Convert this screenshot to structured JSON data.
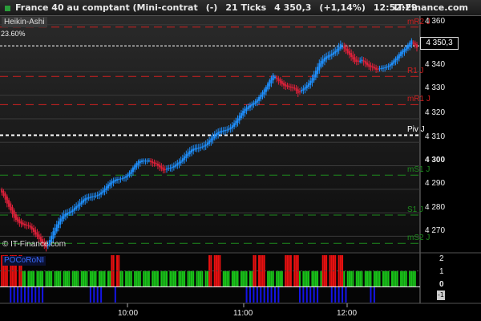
{
  "title_bar": {
    "instrument": "France 40 au comptant (Mini-contrat",
    "mode": "(-)",
    "interval": "21 Ticks",
    "price": "4 350,3",
    "change": "(+1,14%)",
    "time": "12:52:29",
    "brand": "IT-Finance.com"
  },
  "chart_label": "Heikin-Ashi",
  "fib_label": "23.60%",
  "watermark": "© IT-Finance.com",
  "indicator_label": "POCoRoNI",
  "last_price_box": "4 350,3",
  "pivot_labels": [
    "mR2 J",
    "R1 J",
    "mR1 J",
    "Piv J",
    "mS1 J",
    "S1 J",
    "mS2 J"
  ],
  "y_axis_labels": [
    "4 360",
    "4 340",
    "4 330",
    "4 320",
    "4 310",
    "4 300",
    "4 290",
    "4 280",
    "4 270"
  ],
  "x_axis_labels": [
    "10:00",
    "11:00",
    "12:00"
  ],
  "indicator_axis_labels": [
    "2",
    "1",
    "0",
    "-1"
  ],
  "colors": {
    "up_candle": "#1e90ff",
    "down_candle": "#e0203a",
    "resistance": "#d02020",
    "support": "#1e8c1e",
    "pivot": "#ffffff",
    "hist_red": "#e81010",
    "hist_green": "#19c319",
    "hist_blue": "#1414e6"
  },
  "chart_data": {
    "type": "candlestick",
    "y_unit": "points",
    "ylim": [
      4264,
      4363
    ],
    "x_ticks": [
      "10:00",
      "11:00",
      "12:00"
    ],
    "last_price": 4350.3,
    "levels": [
      {
        "name": "mR2 J",
        "value": 4359,
        "style": "dashed",
        "color": "#d02020"
      },
      {
        "name": "R1 J",
        "value": 4338,
        "style": "dashed",
        "color": "#d02020"
      },
      {
        "name": "mR1 J",
        "value": 4326,
        "style": "dashed",
        "color": "#d02020"
      },
      {
        "name": "Piv J",
        "value": 4313,
        "style": "dashed",
        "color": "#ffffff"
      },
      {
        "name": "mS1 J",
        "value": 4296,
        "style": "dashed",
        "color": "#1e8c1e"
      },
      {
        "name": "S1 J",
        "value": 4279,
        "style": "dashed",
        "color": "#1e8c1e"
      },
      {
        "name": "mS2 J",
        "value": 4267,
        "style": "dashed",
        "color": "#1e8c1e"
      }
    ],
    "fib_level": {
      "label": "23.60%",
      "value": 4351
    },
    "price_path": [
      [
        0,
        4290
      ],
      [
        4,
        4283
      ],
      [
        8,
        4278
      ],
      [
        12,
        4276
      ],
      [
        16,
        4274
      ],
      [
        20,
        4270
      ],
      [
        23,
        4268
      ],
      [
        26,
        4266
      ],
      [
        30,
        4272
      ],
      [
        36,
        4279
      ],
      [
        42,
        4283
      ],
      [
        50,
        4286
      ],
      [
        58,
        4290
      ],
      [
        66,
        4294
      ],
      [
        72,
        4297
      ],
      [
        78,
        4301
      ],
      [
        84,
        4303
      ],
      [
        88,
        4301
      ],
      [
        92,
        4297
      ],
      [
        96,
        4299
      ],
      [
        100,
        4302
      ],
      [
        106,
        4305
      ],
      [
        112,
        4308
      ],
      [
        120,
        4312
      ],
      [
        128,
        4316
      ],
      [
        134,
        4320
      ],
      [
        140,
        4325
      ],
      [
        146,
        4330
      ],
      [
        150,
        4333
      ],
      [
        154,
        4338
      ],
      [
        158,
        4336
      ],
      [
        162,
        4334
      ],
      [
        166,
        4332
      ],
      [
        168,
        4330
      ],
      [
        172,
        4334
      ],
      [
        176,
        4338
      ],
      [
        180,
        4343
      ],
      [
        184,
        4346
      ],
      [
        188,
        4349
      ],
      [
        192,
        4352
      ],
      [
        196,
        4347
      ],
      [
        200,
        4344
      ],
      [
        204,
        4346
      ],
      [
        208,
        4342
      ],
      [
        212,
        4340
      ],
      [
        216,
        4342
      ],
      [
        220,
        4344
      ],
      [
        224,
        4346
      ],
      [
        228,
        4349
      ],
      [
        232,
        4354
      ],
      [
        235,
        4351
      ]
    ],
    "indicator": {
      "name": "POCoRoNI",
      "ylim": [
        -1,
        2
      ],
      "segments": [
        {
          "start": 0,
          "end": 12,
          "value": 1.5,
          "color": "red"
        },
        {
          "start": 12,
          "end": 62,
          "value": 0.5,
          "color": "green"
        },
        {
          "start": 62,
          "end": 67,
          "value": 1.5,
          "color": "red"
        },
        {
          "start": 67,
          "end": 100,
          "value": 0.5,
          "color": "green"
        },
        {
          "start": 100,
          "end": 117,
          "value": 0.5,
          "color": "green"
        },
        {
          "start": 117,
          "end": 125,
          "value": 1.5,
          "color": "red"
        },
        {
          "start": 125,
          "end": 142,
          "value": 0.5,
          "color": "green"
        },
        {
          "start": 142,
          "end": 150,
          "value": 1.5,
          "color": "red"
        },
        {
          "start": 150,
          "end": 160,
          "value": 0.5,
          "color": "green"
        },
        {
          "start": 160,
          "end": 168,
          "value": 1.5,
          "color": "red"
        },
        {
          "start": 168,
          "end": 181,
          "value": 0.5,
          "color": "green"
        },
        {
          "start": 181,
          "end": 193,
          "value": 1.5,
          "color": "red"
        },
        {
          "start": 193,
          "end": 235,
          "value": 0.5,
          "color": "green"
        }
      ],
      "negative_spans": [
        {
          "start": 5,
          "end": 25
        },
        {
          "start": 50,
          "end": 58
        },
        {
          "start": 64,
          "end": 66
        },
        {
          "start": 138,
          "end": 158
        },
        {
          "start": 168,
          "end": 180
        },
        {
          "start": 186,
          "end": 196
        },
        {
          "start": 208,
          "end": 212
        }
      ]
    }
  }
}
